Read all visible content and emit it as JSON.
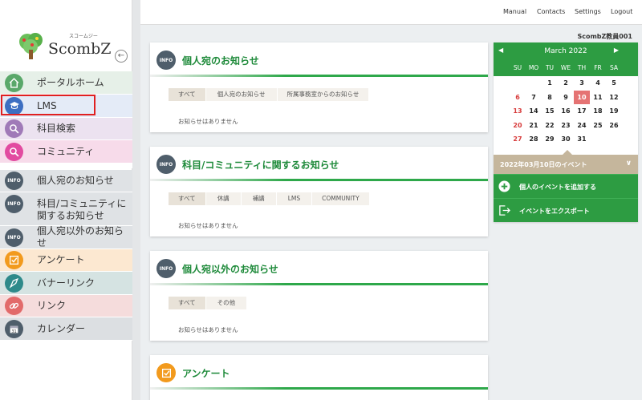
{
  "topnav": {
    "manual": "Manual",
    "contacts": "Contacts",
    "settings": "Settings",
    "logout": "Logout"
  },
  "user": {
    "name": "ScombZ教員001"
  },
  "logo": {
    "brand": "ScombZ",
    "kana": "スコームジー"
  },
  "sidebar": {
    "items": [
      {
        "label": "ポータルホーム",
        "color": "#5aa86a",
        "bg": "#e6f0e8"
      },
      {
        "label": "LMS",
        "color": "#3d6fc2",
        "bg": "#e4ebf7"
      },
      {
        "label": "科目検索",
        "color": "#a07ab8",
        "bg": "#ece2f0"
      },
      {
        "label": "コミュニティ",
        "color": "#e24ba0",
        "bg": "#f7dbea"
      },
      {
        "label": "個人宛のお知らせ",
        "color": "#4f5e6b",
        "bg": "#dfe2e5"
      },
      {
        "label1": "科目/コミュニティに",
        "label2": "関するお知らせ",
        "color": "#4f5e6b",
        "bg": "#dfe2e5"
      },
      {
        "label": "個人宛以外のお知らせ",
        "color": "#4f5e6b",
        "bg": "#dfe2e5"
      },
      {
        "label": "アンケート",
        "color": "#f29a1d",
        "bg": "#fce8d1"
      },
      {
        "label": "バナーリンク",
        "color": "#2e8a8a",
        "bg": "#d5e3e2"
      },
      {
        "label": "リンク",
        "color": "#e26a6a",
        "bg": "#f5dcdc"
      },
      {
        "label": "カレンダー",
        "color": "#4f5e6b",
        "bg": "#dcdfe2"
      }
    ]
  },
  "cards": {
    "personal": {
      "title": "個人宛のお知らせ",
      "tabs": [
        "すべて",
        "個人宛のお知らせ",
        "所属事務室からのお知らせ"
      ],
      "empty": "お知らせはありません",
      "icon": "INFO"
    },
    "course": {
      "title": "科目/コミュニティに関するお知らせ",
      "tabs": [
        "すべて",
        "休講",
        "補講",
        "LMS",
        "COMMUNITY"
      ],
      "empty": "お知らせはありません",
      "icon": "INFO"
    },
    "other": {
      "title": "個人宛以外のお知らせ",
      "tabs": [
        "すべて",
        "その他"
      ],
      "empty": "お知らせはありません",
      "icon": "INFO"
    },
    "survey": {
      "title": "アンケート"
    }
  },
  "calendar": {
    "month": "March 2022",
    "prev": "◀",
    "next": "▶",
    "dow": [
      "SU",
      "MO",
      "TU",
      "WE",
      "TH",
      "FR",
      "SA"
    ],
    "weeks": [
      [
        "",
        "",
        "1",
        "2",
        "3",
        "4",
        "5"
      ],
      [
        "6",
        "7",
        "8",
        "9",
        "10",
        "11",
        "12"
      ],
      [
        "13",
        "14",
        "15",
        "16",
        "17",
        "18",
        "19"
      ],
      [
        "20",
        "21",
        "22",
        "23",
        "24",
        "25",
        "26"
      ],
      [
        "27",
        "28",
        "29",
        "30",
        "31",
        "",
        ""
      ]
    ],
    "today": "10",
    "event_header": "2022年03月10日のイベント",
    "add_event": "個人のイベントを追加する",
    "export_event": "イベントをエクスポート"
  }
}
